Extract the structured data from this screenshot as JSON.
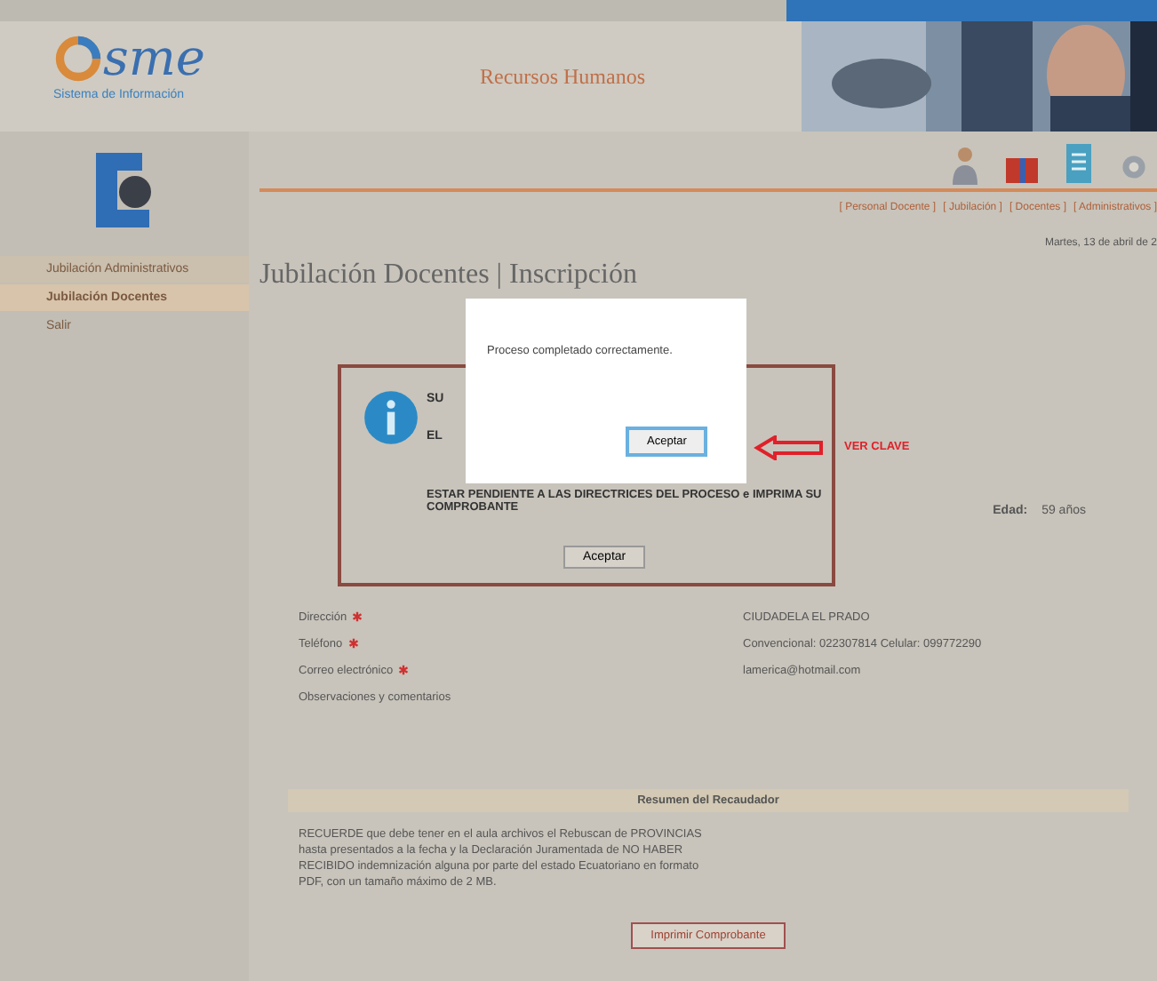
{
  "logo": {
    "text": "sme",
    "subtitle": "Sistema de Información"
  },
  "header": {
    "title": "Recursos Humanos"
  },
  "nav": [
    "[ Personal Docente ]",
    "[ Jubilación ]",
    "[ Docentes ]",
    "[ Administrativos ]"
  ],
  "sidebar": {
    "items": [
      {
        "label": "Jubilación Administrativos",
        "selected": false
      },
      {
        "label": "Jubilación Docentes",
        "selected": true
      },
      {
        "label": "Salir",
        "selected": false
      }
    ]
  },
  "date": "Martes, 13 de abril de 2",
  "page_title": "Jubilación Docentes | Inscripción",
  "form": {
    "fields": [
      {
        "label": "Dirección",
        "required": true,
        "value": "CIUDADELA EL PRADO"
      },
      {
        "label": "Teléfono",
        "required": true,
        "value": "Convencional: 022307814     Celular: 099772290"
      },
      {
        "label": "Correo electrónico",
        "required": true,
        "value": "lamerica@hotmail.com"
      },
      {
        "label": "Observaciones y comentarios",
        "required": false
      }
    ],
    "age_label": "Edad:",
    "age_value": "59 años"
  },
  "summary": {
    "title": "Resumen del Recaudador",
    "text": "RECUERDE que debe tener en el aula archivos el Rebuscan de PROVINCIAS hasta presentados a la fecha y la Declaración Juramentada de NO HABER RECIBIDO indemnización alguna por parte del estado Ecuatoriano en formato PDF, con un tamaño máximo de 2 MB.",
    "button": "Imprimir Comprobante"
  },
  "annotation": "VER CLAVE",
  "info_dialog": {
    "lines": [
      "SU",
      "EL"
    ],
    "message": "ESTAR PENDIENTE A LAS DIRECTRICES DEL PROCESO e IMPRIMA SU COMPROBANTE",
    "button": "Aceptar"
  },
  "alert": {
    "message": "Proceso completado correctamente.",
    "button": "Aceptar"
  }
}
